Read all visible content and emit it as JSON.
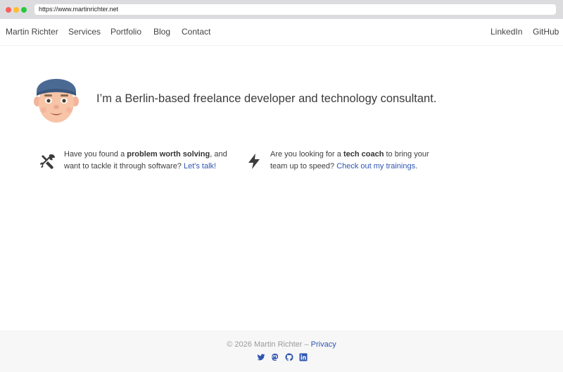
{
  "browser": {
    "url": "https://www.martinrichter.net"
  },
  "nav": {
    "brand": "Martin Richter",
    "items": [
      "Services",
      "Portfolio",
      "Blog",
      "Contact"
    ],
    "right_items": [
      "LinkedIn",
      "GitHub"
    ]
  },
  "hero": {
    "tagline": "I’m a Berlin-based freelance developer and technology consultant."
  },
  "features": [
    {
      "icon": "tools-icon",
      "pre": "Have you found a ",
      "bold": "problem worth solving",
      "mid": ", and want to tackle it through software? ",
      "link": "Let's talk!",
      "post": ""
    },
    {
      "icon": "lightning-icon",
      "pre": "Are you looking for a ",
      "bold": "tech coach",
      "mid": " to bring your team up to speed? ",
      "link": "Check out my trainings",
      "post": "."
    }
  ],
  "footer": {
    "copyright": "© 2026 Martin Richter –",
    "privacy": "Privacy",
    "socials": [
      "twitter-icon",
      "mastodon-icon",
      "github-icon",
      "linkedin-icon"
    ]
  },
  "colors": {
    "link": "#2f55b2",
    "icon": "#3d3d3d"
  }
}
